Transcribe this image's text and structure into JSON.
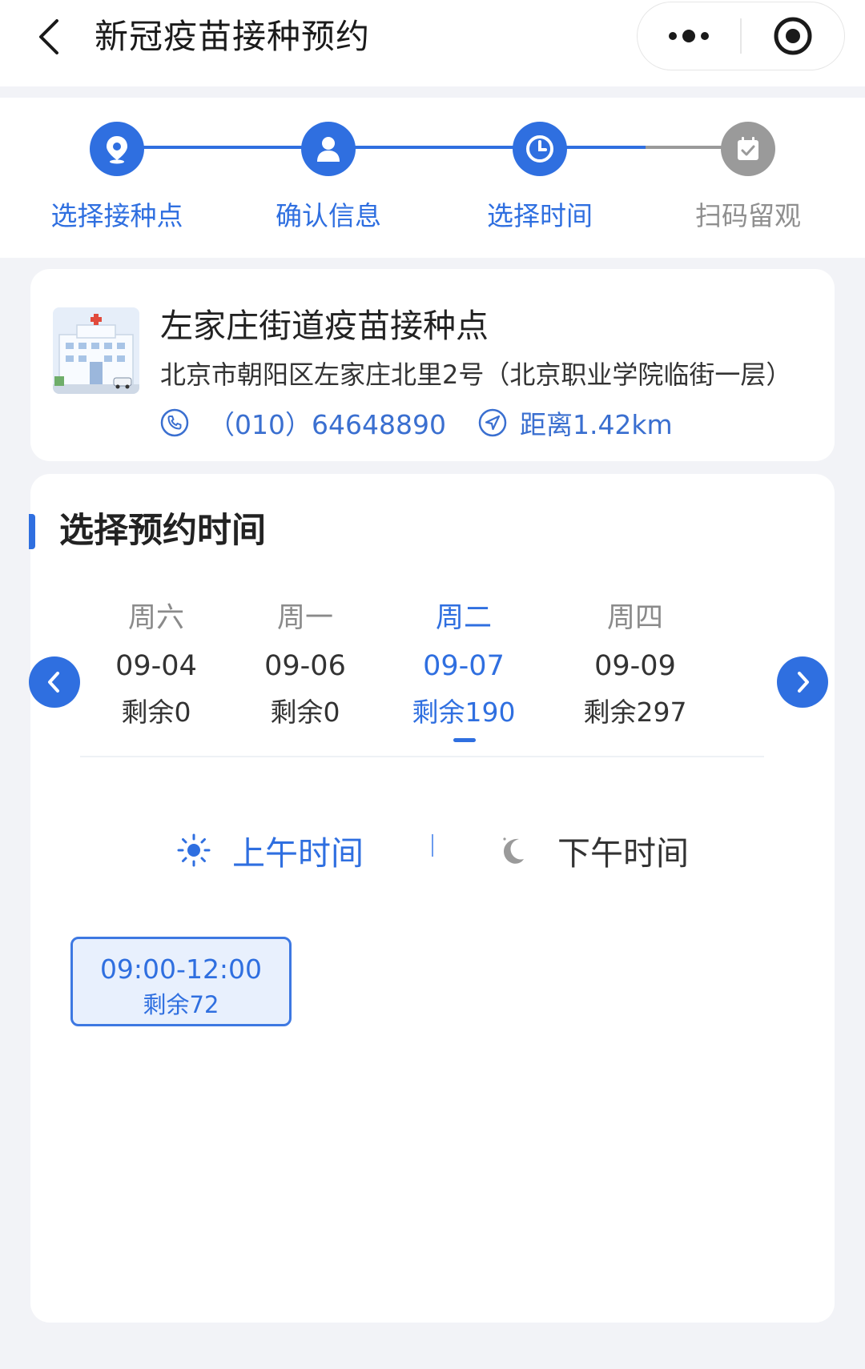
{
  "nav": {
    "title": "新冠疫苗接种预约"
  },
  "steps": [
    {
      "label": "选择接种点",
      "state": "done",
      "icon": "location-pin-icon"
    },
    {
      "label": "确认信息",
      "state": "done",
      "icon": "user-icon"
    },
    {
      "label": "选择时间",
      "state": "current",
      "icon": "clock-icon"
    },
    {
      "label": "扫码留观",
      "state": "pending",
      "icon": "calendar-check-icon"
    }
  ],
  "site": {
    "name": "左家庄街道疫苗接种点",
    "address": "北京市朝阳区左家庄北里2号（北京职业学院临街一层）",
    "phone": "（010）64648890",
    "distance": "距离1.42km"
  },
  "booking": {
    "section_title": "选择预约时间",
    "dates": [
      {
        "weekday": "周六",
        "date": "09-04",
        "remaining": "剩余0",
        "selected": false
      },
      {
        "weekday": "周一",
        "date": "09-06",
        "remaining": "剩余0",
        "selected": false
      },
      {
        "weekday": "周二",
        "date": "09-07",
        "remaining": "剩余190",
        "selected": true
      },
      {
        "weekday": "周四",
        "date": "09-09",
        "remaining": "剩余297",
        "selected": false
      }
    ],
    "periods": {
      "morning": "上午时间",
      "afternoon": "下午时间",
      "active": "morning"
    },
    "slots": [
      {
        "time": "09:00-12:00",
        "remaining": "剩余72",
        "selected": true
      }
    ]
  },
  "colors": {
    "primary": "#2f6fe0",
    "pending": "#9a9a9a",
    "text": "#333333",
    "slot_bg": "#e8f0fd"
  }
}
